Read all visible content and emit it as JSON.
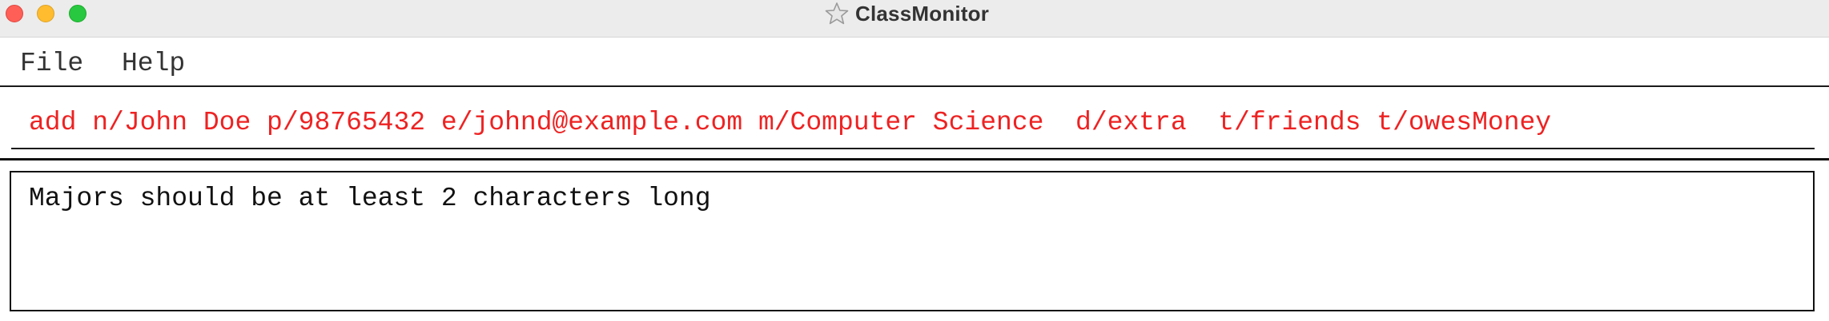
{
  "window": {
    "title": "ClassMonitor",
    "app_icon": "star-icon"
  },
  "menubar": {
    "file_label": "File",
    "help_label": "Help"
  },
  "command_box": {
    "value": "add n/John Doe p/98765432 e/johnd@example.com m/Computer Science  d/extra  t/friends t/owesMoney",
    "text_color": "#ee2222"
  },
  "result_display": {
    "message": "Majors should be at least 2 characters long"
  },
  "colors": {
    "error_text": "#ee2222",
    "close_button": "#ff5f57",
    "minimize_button": "#febc2e",
    "maximize_button": "#28c840"
  }
}
